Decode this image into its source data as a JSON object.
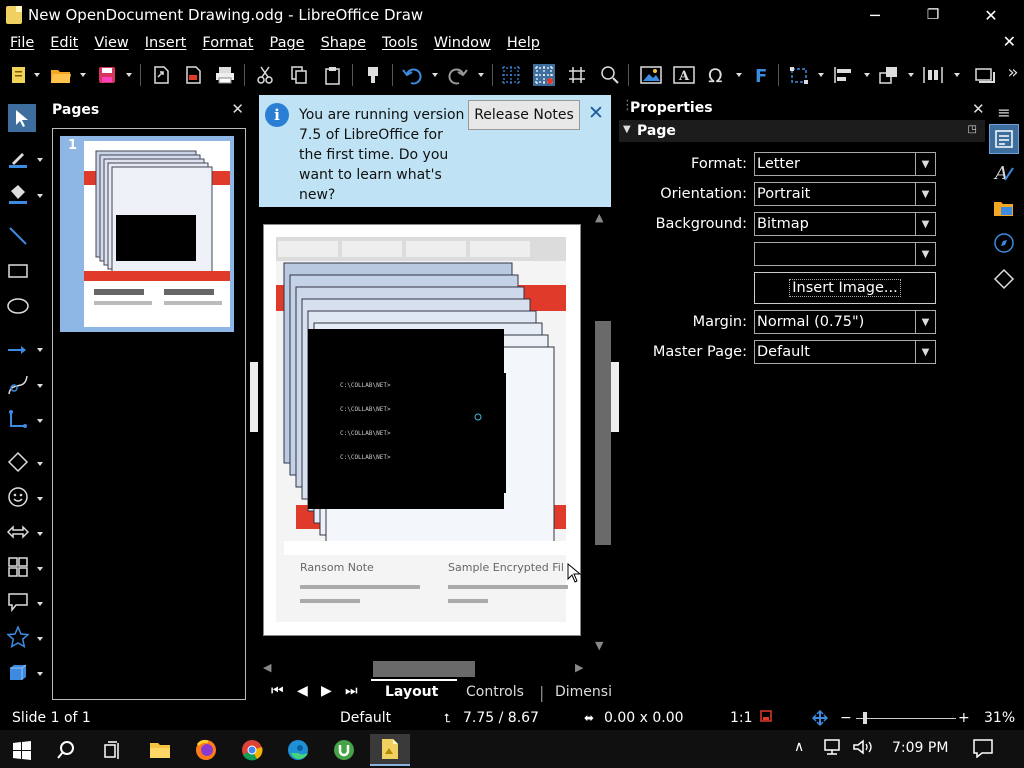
{
  "window": {
    "title": "New OpenDocument Drawing.odg - LibreOffice Draw",
    "minimize": "─",
    "restore": "❐",
    "close": "✕"
  },
  "menubar": {
    "items": [
      "File",
      "Edit",
      "View",
      "Insert",
      "Format",
      "Page",
      "Shape",
      "Tools",
      "Window",
      "Help"
    ],
    "close": "✕"
  },
  "toolbar": {
    "more": "»"
  },
  "pages_pane": {
    "title": "Pages",
    "close": "✕",
    "page_number": "1"
  },
  "infobar": {
    "message": "You are running version 7.5 of LibreOffice for the first time. Do you want to learn what's new?",
    "button": "Release Notes",
    "close": "✕"
  },
  "tabs": {
    "items": [
      "Layout",
      "Controls",
      "Dimensi"
    ],
    "active": "Layout"
  },
  "properties": {
    "title": "Properties",
    "close": "✕",
    "menu": "≡",
    "section": "Page",
    "fields": {
      "format_label": "Format:",
      "format_value": "Letter",
      "orientation_label": "Orientation:",
      "orientation_value": "Portrait",
      "background_label": "Background:",
      "background_value": "Bitmap",
      "background_extra_value": "",
      "insert_image": "Insert Image...",
      "margin_label": "Margin:",
      "margin_value": "Normal (0.75\")",
      "master_page_label": "Master Page:",
      "master_page_value": "Default"
    }
  },
  "statusbar": {
    "slide": "Slide 1 of 1",
    "master": "Default",
    "position": "7.75 / 8.67",
    "size": "0.00 x 0.00",
    "scale": "1:1",
    "zoom": "31%",
    "zoom_level": 0.31
  },
  "taskbar": {
    "clock": "7:09 PM"
  },
  "colors": {
    "accent": "#2a7fd4",
    "infobar_bg": "#bfe3f5",
    "thumb_selection": "#8fb7e6",
    "alert_red": "#e03a2a"
  }
}
